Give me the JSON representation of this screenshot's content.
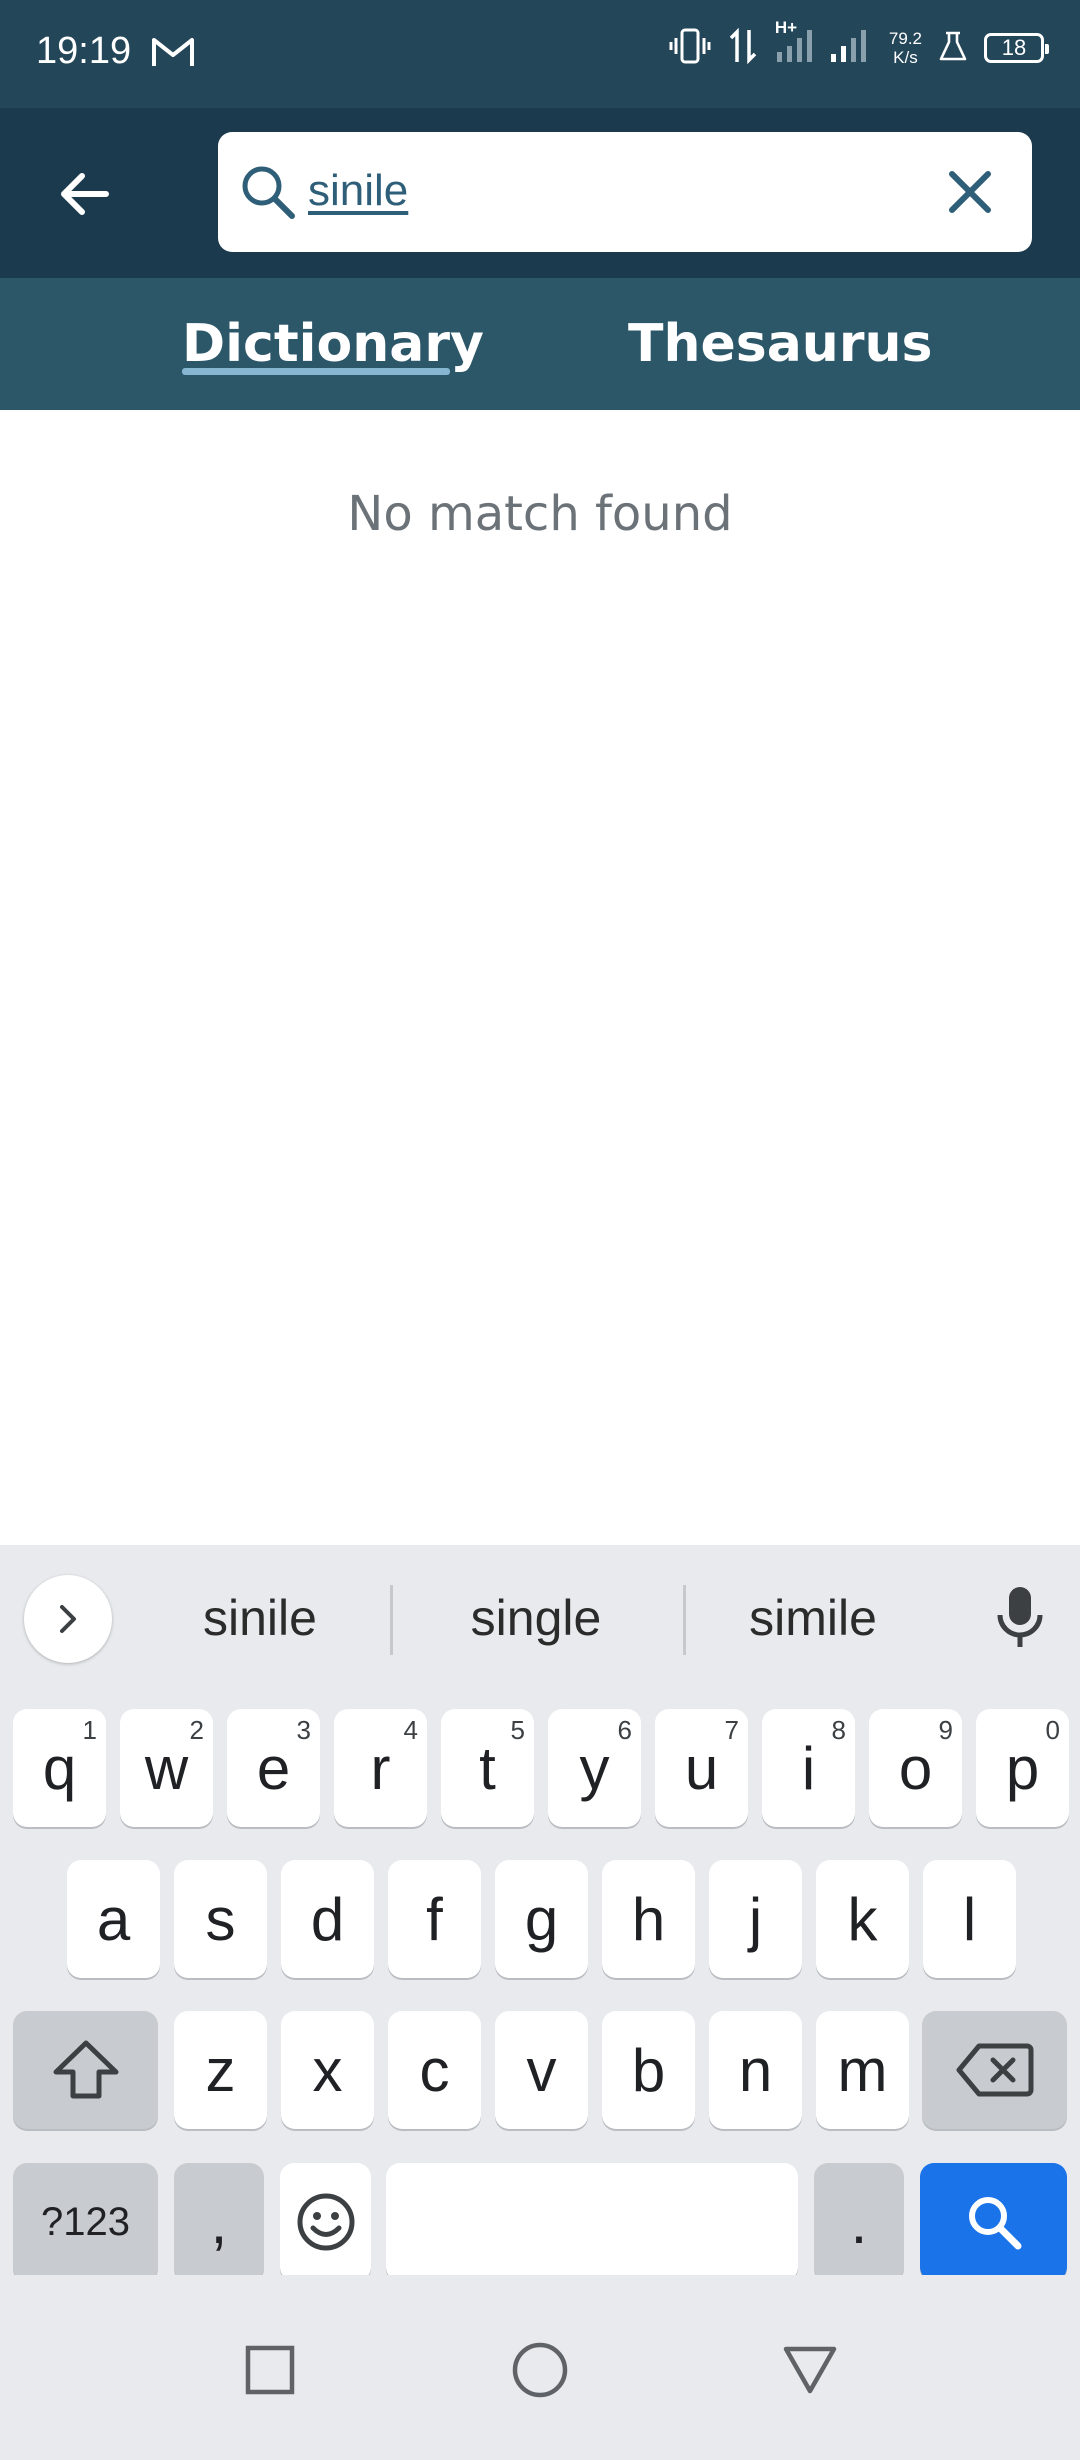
{
  "status_bar": {
    "time": "19:19",
    "network_type": "H+",
    "speed_value": "79.2",
    "speed_unit": "K/s",
    "battery": "18"
  },
  "app_bar": {
    "search_value": "sinile"
  },
  "tabs": [
    {
      "label": "Dictionary",
      "selected": true
    },
    {
      "label": "Thesaurus",
      "selected": false
    }
  ],
  "content": {
    "message": "No match found"
  },
  "keyboard": {
    "suggestions": [
      "sinile",
      "single",
      "simile"
    ],
    "row1": [
      {
        "key": "q",
        "hint": "1"
      },
      {
        "key": "w",
        "hint": "2"
      },
      {
        "key": "e",
        "hint": "3"
      },
      {
        "key": "r",
        "hint": "4"
      },
      {
        "key": "t",
        "hint": "5"
      },
      {
        "key": "y",
        "hint": "6"
      },
      {
        "key": "u",
        "hint": "7"
      },
      {
        "key": "i",
        "hint": "8"
      },
      {
        "key": "o",
        "hint": "9"
      },
      {
        "key": "p",
        "hint": "0"
      }
    ],
    "row2": [
      "a",
      "s",
      "d",
      "f",
      "g",
      "h",
      "j",
      "k",
      "l"
    ],
    "row3": [
      "z",
      "x",
      "c",
      "v",
      "b",
      "n",
      "m"
    ],
    "symbols_label": "?123",
    "comma_label": ",",
    "period_label": "."
  },
  "colors": {
    "status_bar": "#234659",
    "app_bar": "#1c3a4e",
    "tab_bar": "#2c5769",
    "accent_blue": "#1a73e8"
  }
}
